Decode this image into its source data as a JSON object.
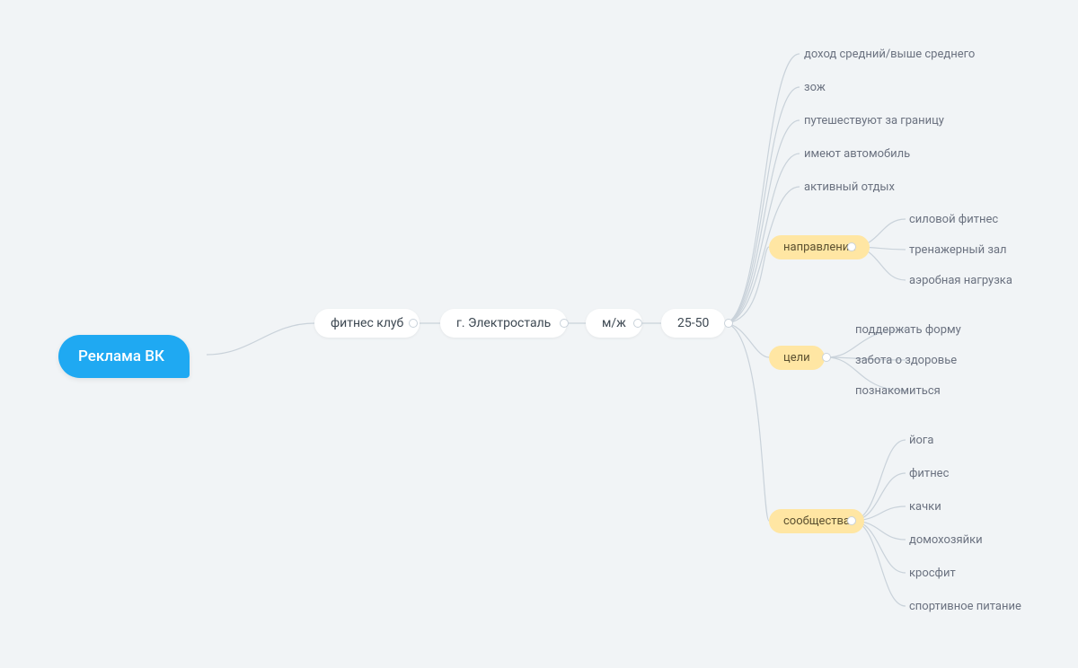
{
  "root": {
    "label": "Реклама ВК"
  },
  "chain": [
    {
      "label": "фитнес клуб"
    },
    {
      "label": "г. Электросталь"
    },
    {
      "label": "м/ж"
    },
    {
      "label": "25-50"
    }
  ],
  "directLeaves": [
    "доход средний/выше среднего",
    "зож",
    "путешествуют за границу",
    "имеют автомобиль",
    "активный отдых"
  ],
  "categories": [
    {
      "name": "направления",
      "items": [
        "силовой фитнес",
        "тренажерный зал",
        "аэробная нагрузка"
      ]
    },
    {
      "name": "цели",
      "items": [
        "поддержать форму",
        "забота о здоровье",
        "познакомиться"
      ]
    },
    {
      "name": "сообщества",
      "items": [
        "йога",
        "фитнес",
        "качки",
        "домохозяйки",
        "кросфит",
        "спортивное питание"
      ]
    }
  ]
}
